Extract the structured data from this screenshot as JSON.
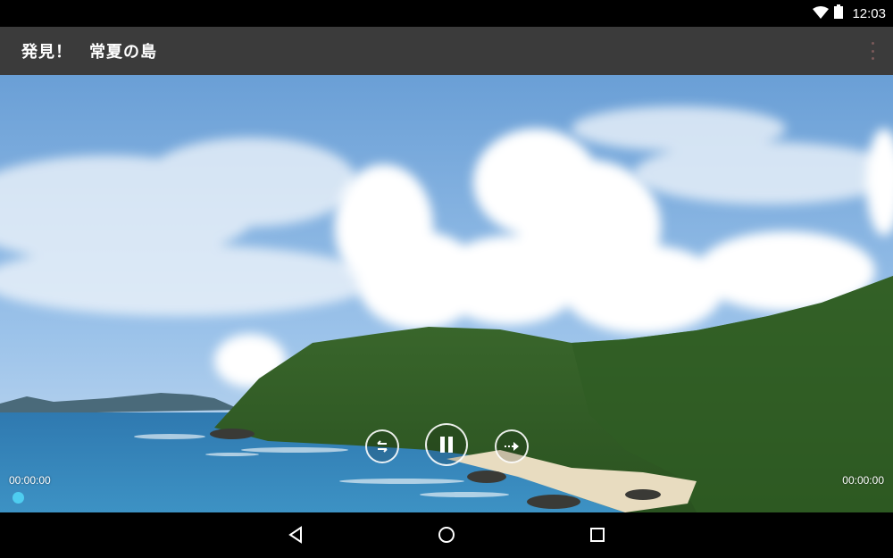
{
  "status_bar": {
    "time": "12:03",
    "icons": [
      "wifi-icon",
      "battery-icon"
    ]
  },
  "app_bar": {
    "title": "発見！　常夏の島",
    "overflow_icon": "more-vert-icon"
  },
  "player": {
    "elapsed": "00:00:00",
    "duration": "00:00:00",
    "progress": 0,
    "controls": [
      "rewind-icon",
      "pause-icon",
      "fast-forward-icon"
    ],
    "accent_color": "#4ecdf0"
  },
  "nav_bar": {
    "icons": [
      "back-icon",
      "home-icon",
      "recents-icon"
    ]
  }
}
